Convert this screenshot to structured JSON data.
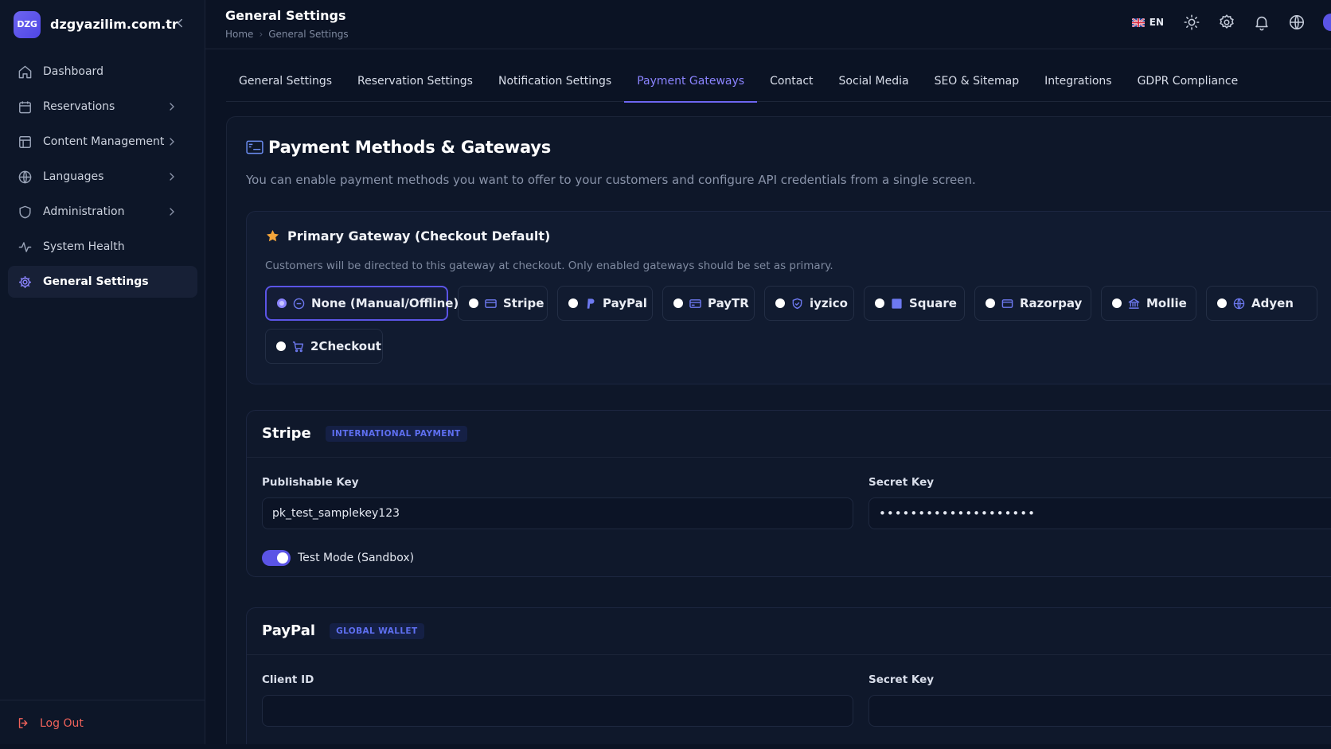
{
  "brand": {
    "logo_text": "DZG",
    "name": "dzgyazilim.com.tr"
  },
  "sidebar": {
    "items": [
      {
        "label": "Dashboard",
        "icon": "home-icon",
        "has_submenu": false,
        "active": false
      },
      {
        "label": "Reservations",
        "icon": "calendar-icon",
        "has_submenu": true,
        "active": false
      },
      {
        "label": "Content Management",
        "icon": "layout-icon",
        "has_submenu": true,
        "active": false
      },
      {
        "label": "Languages",
        "icon": "globe-icon",
        "has_submenu": true,
        "active": false
      },
      {
        "label": "Administration",
        "icon": "shield-icon",
        "has_submenu": true,
        "active": false
      },
      {
        "label": "System Health",
        "icon": "activity-icon",
        "has_submenu": false,
        "active": false
      },
      {
        "label": "General Settings",
        "icon": "gear-icon",
        "has_submenu": false,
        "active": true
      }
    ],
    "logout_label": "Log Out"
  },
  "header": {
    "title": "General Settings",
    "breadcrumb": [
      "Home",
      "General Settings"
    ],
    "language": "EN"
  },
  "tabs": [
    {
      "label": "General Settings",
      "active": false
    },
    {
      "label": "Reservation Settings",
      "active": false
    },
    {
      "label": "Notification Settings",
      "active": false
    },
    {
      "label": "Payment Gateways",
      "active": true
    },
    {
      "label": "Contact",
      "active": false
    },
    {
      "label": "Social Media",
      "active": false
    },
    {
      "label": "SEO & Sitemap",
      "active": false
    },
    {
      "label": "Integrations",
      "active": false
    },
    {
      "label": "GDPR Compliance",
      "active": false
    }
  ],
  "payment": {
    "title": "Payment Methods & Gateways",
    "description": "You can enable payment methods you want to offer to your customers and configure API credentials from a single screen.",
    "primary": {
      "title": "Primary Gateway (Checkout Default)",
      "description": "Customers will be directed to this gateway at checkout. Only enabled gateways should be set as primary.",
      "options": [
        {
          "label": "None (Manual/Offline)",
          "icon": "circle-minus-icon",
          "selected": true
        },
        {
          "label": "Stripe",
          "icon": "credit-card-icon",
          "selected": false
        },
        {
          "label": "PayPal",
          "icon": "paypal-icon",
          "selected": false
        },
        {
          "label": "PayTR",
          "icon": "credit-card-icon",
          "selected": false
        },
        {
          "label": "iyzico",
          "icon": "shield-check-icon",
          "selected": false
        },
        {
          "label": "Square",
          "icon": "square-icon",
          "selected": false
        },
        {
          "label": "Razorpay",
          "icon": "wallet-icon",
          "selected": false
        },
        {
          "label": "Mollie",
          "icon": "bank-icon",
          "selected": false
        },
        {
          "label": "Adyen",
          "icon": "globe-icon",
          "selected": false
        },
        {
          "label": "2Checkout",
          "icon": "cart-icon",
          "selected": false
        }
      ]
    },
    "stripe": {
      "title": "Stripe",
      "badge": "INTERNATIONAL PAYMENT",
      "publishable_label": "Publishable Key",
      "publishable_value": "pk_test_samplekey123",
      "secret_label": "Secret Key",
      "secret_value": "••••••••••••••••••••",
      "test_mode_label": "Test Mode (Sandbox)",
      "test_mode_on": true
    },
    "paypal": {
      "title": "PayPal",
      "badge": "GLOBAL WALLET",
      "client_id_label": "Client ID",
      "client_id_value": "",
      "secret_label": "Secret Key",
      "secret_value": ""
    }
  },
  "colors": {
    "accent": "#6d65f0",
    "background": "#0b1324",
    "danger": "#f0625a",
    "star": "#f4a53b"
  }
}
